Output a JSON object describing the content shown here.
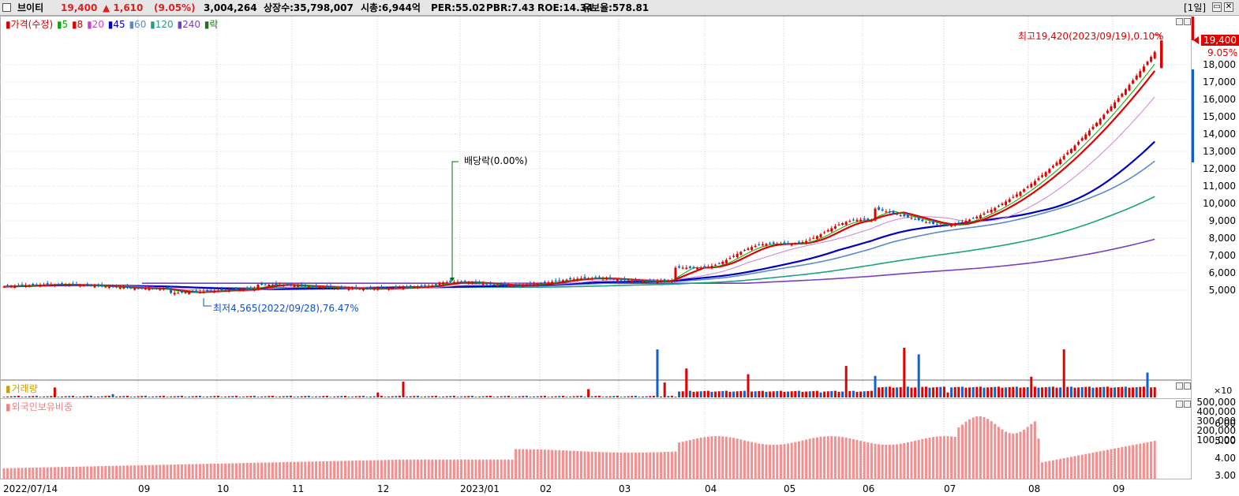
{
  "header": {
    "stock_name": "브이티",
    "price": "19,400",
    "change": "▲ 1,610",
    "change_pct": "(9.05%)",
    "volume": "3,004,264",
    "listed_shares": "상장수:35,798,007",
    "market_cap": "시총:6,944억",
    "per": "PER:55.02",
    "pbr": "PBR:7.43",
    "roe": "ROE:14.34",
    "retention": "유보율:578.81",
    "period": "[1일]",
    "restore_icon": "restore-icon",
    "close_icon": "close-icon"
  },
  "price_panel": {
    "legend": [
      {
        "text": "가격(수정)",
        "color": "#d40000"
      },
      {
        "text": "5",
        "color": "#00b000"
      },
      {
        "text": "8",
        "color": "#e00000"
      },
      {
        "text": "20",
        "color": "#cc44cc"
      },
      {
        "text": "45",
        "color": "#0000c0"
      },
      {
        "text": "60",
        "color": "#5a8ac8"
      },
      {
        "text": "120",
        "color": "#20a080"
      },
      {
        "text": "240",
        "color": "#7b3fbf"
      },
      {
        "text": "락",
        "color": "#207020"
      }
    ],
    "high_note": "최고19,420(2023/09/19),0.10%",
    "low_note": "최저4,565(2022/09/28),76.47%",
    "dividend_note": "배당락(0.00%)",
    "current_price_tag": "19,400",
    "current_pct_tag": "9.05%",
    "y_ticks": [
      "18,000",
      "17,000",
      "16,000",
      "15,000",
      "14,000",
      "13,000",
      "12,000",
      "11,000",
      "10,000",
      "9,000",
      "8,000",
      "7,000",
      "6,000",
      "5,000"
    ]
  },
  "volume_panel": {
    "legend": "거래량",
    "legend_color": "#c8a000",
    "y_ticks": [
      "500,000",
      "400,000",
      "300,000",
      "200,000",
      "100,000"
    ],
    "unit": "×10"
  },
  "foreign_panel": {
    "legend": "외국인보유비중",
    "legend_color": "#f08080",
    "y_ticks": [
      "6.00",
      "5.00",
      "4.00",
      "3.00"
    ]
  },
  "x_axis": {
    "labels": [
      "2022/07/14",
      "09",
      "10",
      "11",
      "12",
      "2023/01",
      "02",
      "03",
      "04",
      "05",
      "06",
      "07",
      "08",
      "09"
    ]
  },
  "colors": {
    "up": "#e00000",
    "down": "#1060d0",
    "foreign_bar": "#f09090"
  }
}
